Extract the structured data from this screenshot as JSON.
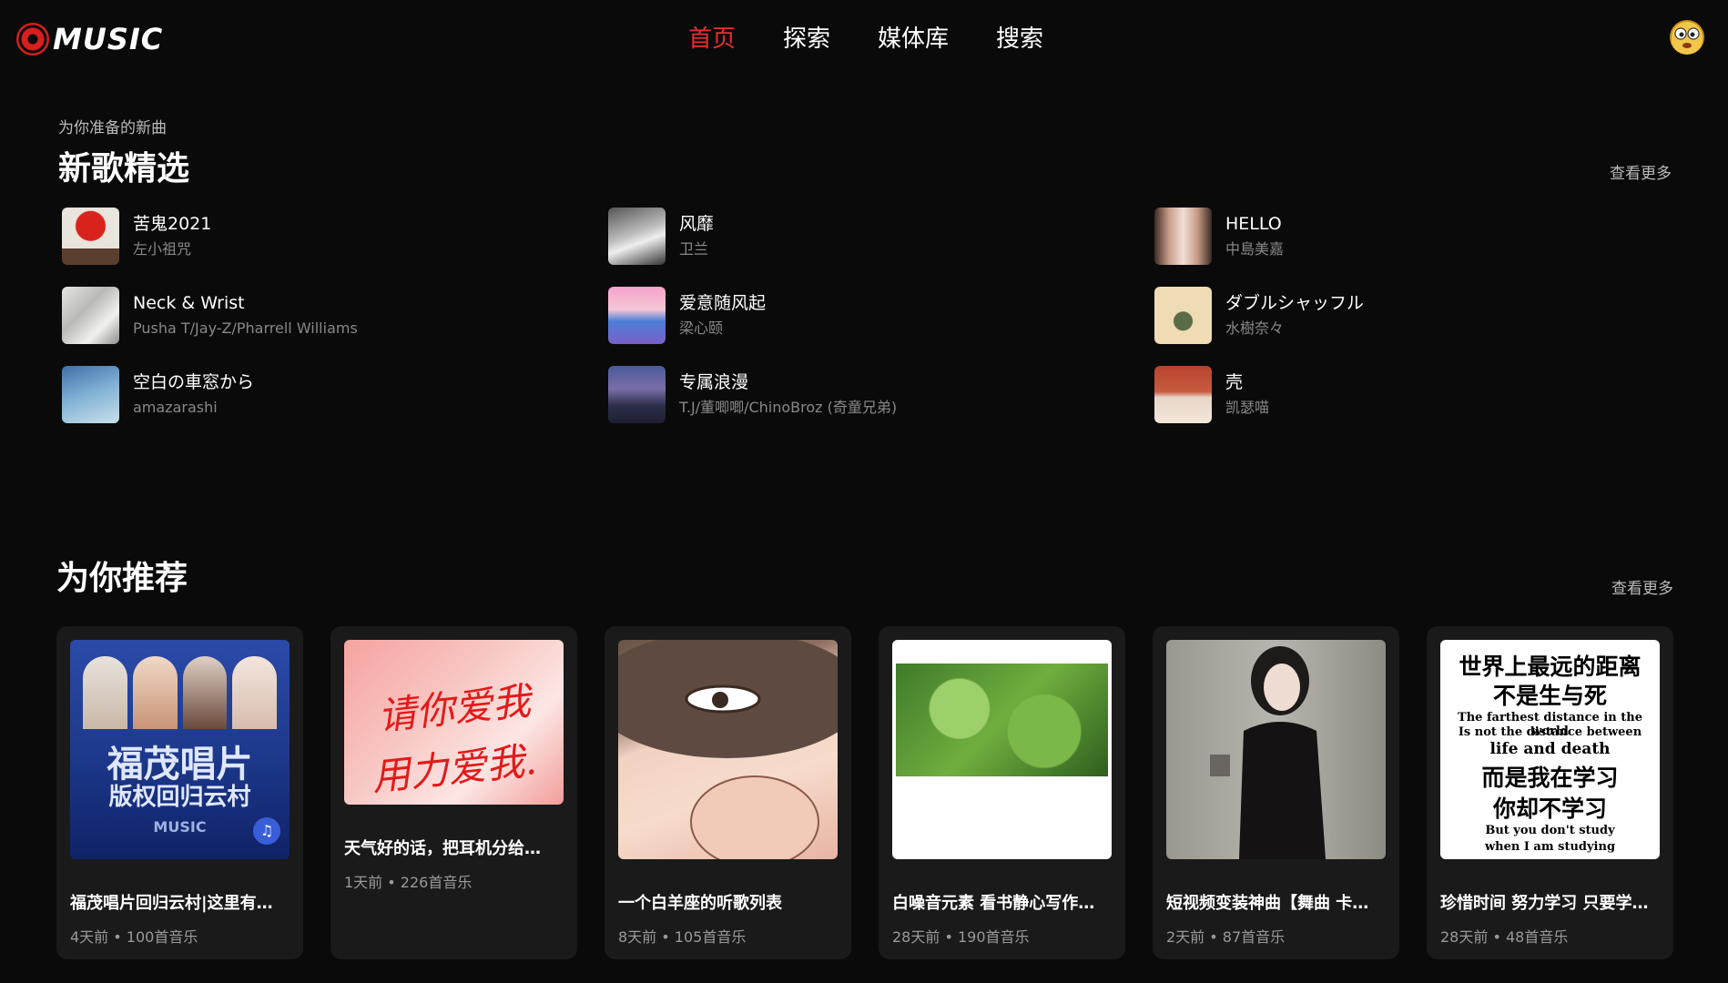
{
  "header": {
    "logo_text": "MUSIC",
    "nav": [
      {
        "label": "首页",
        "active": true
      },
      {
        "label": "探索",
        "active": false
      },
      {
        "label": "媒体库",
        "active": false
      },
      {
        "label": "搜索",
        "active": false
      }
    ]
  },
  "new_songs": {
    "subtitle": "为你准备的新曲",
    "title": "新歌精选",
    "more_label": "查看更多",
    "songs": [
      {
        "title": "苦鬼2021",
        "artist": "左小祖咒"
      },
      {
        "title": "风靡",
        "artist": "卫兰"
      },
      {
        "title": "HELLO",
        "artist": "中島美嘉"
      },
      {
        "title": "Neck & Wrist",
        "artist": "Pusha T/Jay-Z/Pharrell Williams"
      },
      {
        "title": "爱意随风起",
        "artist": "梁心颐"
      },
      {
        "title": "ダブルシャッフル",
        "artist": "水樹奈々"
      },
      {
        "title": "空白の車窓から",
        "artist": "amazarashi"
      },
      {
        "title": "专属浪漫",
        "artist": "T.J/董唧唧/ChinoBroz (奇童兄弟)"
      },
      {
        "title": "壳",
        "artist": "凯瑟喵"
      }
    ]
  },
  "recommend": {
    "title": "为你推荐",
    "more_label": "查看更多",
    "playlists": [
      {
        "title": "福茂唱片回归云村|这里有…",
        "meta": "4天前 • 100首音乐",
        "cover_line1": "福茂唱片",
        "cover_line2": "版权回归云村",
        "cover_badge": "MUSIC"
      },
      {
        "title": "天气好的话，把耳机分给…",
        "meta": "1天前 • 226首音乐",
        "cover_line1": "请你爱我",
        "cover_line2": "用力爱我."
      },
      {
        "title": "一个白羊座的听歌列表",
        "meta": "8天前 • 105首音乐"
      },
      {
        "title": "白噪音元素 看书静心写作…",
        "meta": "28天前 • 190首音乐"
      },
      {
        "title": "短视频变装神曲【舞曲 卡…",
        "meta": "2天前 • 87首音乐"
      },
      {
        "title": "珍惜时间 努力学习 只要学…",
        "meta": "28天前 • 48首音乐",
        "cover_lines": [
          "世界上最远的距离",
          "不是生与死",
          "The farthest distance in the world",
          "Is not the distance between",
          "life and death",
          "而是我在学习",
          "你却不学习",
          "But you don't study",
          "when I am studying"
        ]
      }
    ]
  }
}
